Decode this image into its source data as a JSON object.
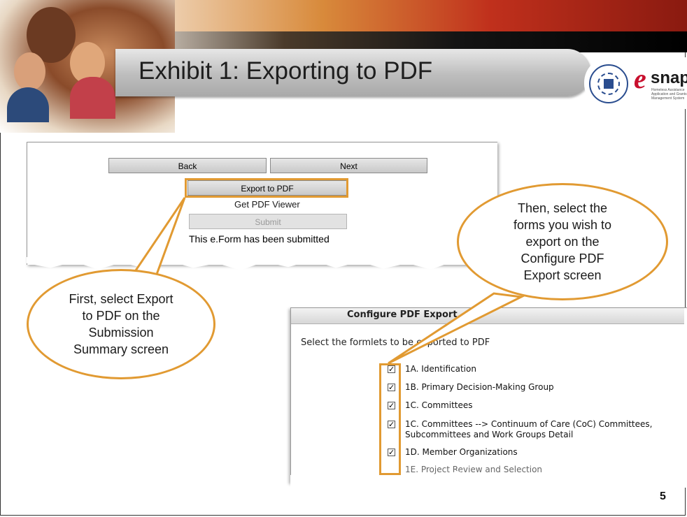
{
  "slide": {
    "title": "Exhibit 1:  Exporting to PDF",
    "page_number": "5",
    "accent_color": "#e19a32",
    "logos": {
      "hud": "hud-seal-icon",
      "esnaps_e": "e",
      "esnaps_text": "snaps",
      "esnaps_sub": "Homeless Assistance Application and Grants Management System"
    }
  },
  "submission_screen": {
    "back_label": "Back",
    "next_label": "Next",
    "export_label": "Export to PDF",
    "pdf_viewer_link": "Get PDF Viewer",
    "submit_label": "Submit",
    "status_message": "This e.Form has been submitted"
  },
  "configure_screen": {
    "title": "Configure PDF Export",
    "instructions": "Select the formlets to be exported to PDF",
    "formlets": [
      {
        "label": "1A. Identification",
        "checked": true
      },
      {
        "label": "1B. Primary Decision-Making Group",
        "checked": true
      },
      {
        "label": "1C. Committees",
        "checked": true
      },
      {
        "label": "1C. Committees --> Continuum of Care (CoC) Committees, Subcommittees and Work Groups Detail",
        "checked": true
      },
      {
        "label": "1D. Member Organizations",
        "checked": true
      }
    ],
    "partial_item": "1E. Project Review and Selection"
  },
  "callouts": {
    "first_lines": [
      "First, select Export",
      "to PDF on the",
      "Submission",
      "Summary screen"
    ],
    "then_lines": [
      "Then, select the",
      "forms you wish to",
      "export on the",
      "Configure PDF",
      "Export screen"
    ]
  }
}
